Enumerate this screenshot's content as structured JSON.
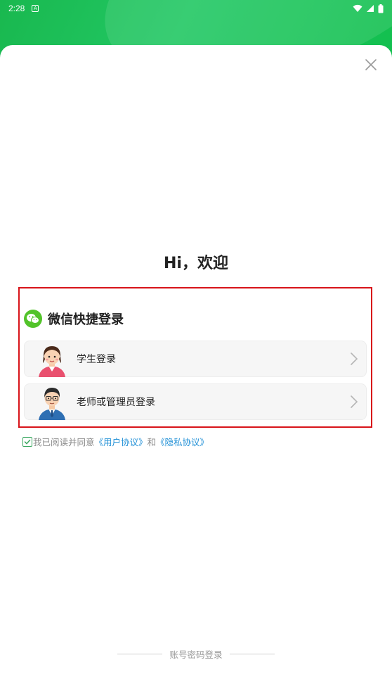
{
  "status_bar": {
    "time": "2:28",
    "notification_icon": "a-notification-icon",
    "wifi_icon": "wifi-icon",
    "signal_icon": "signal-icon",
    "battery_icon": "battery-icon"
  },
  "dialog": {
    "close_icon": "close-icon",
    "greeting": "Hi，欢迎",
    "wechat": {
      "icon": "wechat-icon",
      "title": "微信快捷登录",
      "options": [
        {
          "label": "学生登录",
          "avatar": "student-avatar-icon"
        },
        {
          "label": "老师或管理员登录",
          "avatar": "teacher-avatar-icon"
        }
      ]
    },
    "agreement": {
      "checked": true,
      "prefix": "我已阅读并同意",
      "user_agreement": "《用户协议》",
      "and": "和",
      "privacy_agreement": "《隐私协议》"
    },
    "footer": {
      "account_login": "账号密码登录"
    }
  },
  "colors": {
    "header_green": "#1cc25a",
    "wechat_green": "#52c32a",
    "link_blue": "#1f8fd6",
    "highlight_red": "#d8141a"
  }
}
